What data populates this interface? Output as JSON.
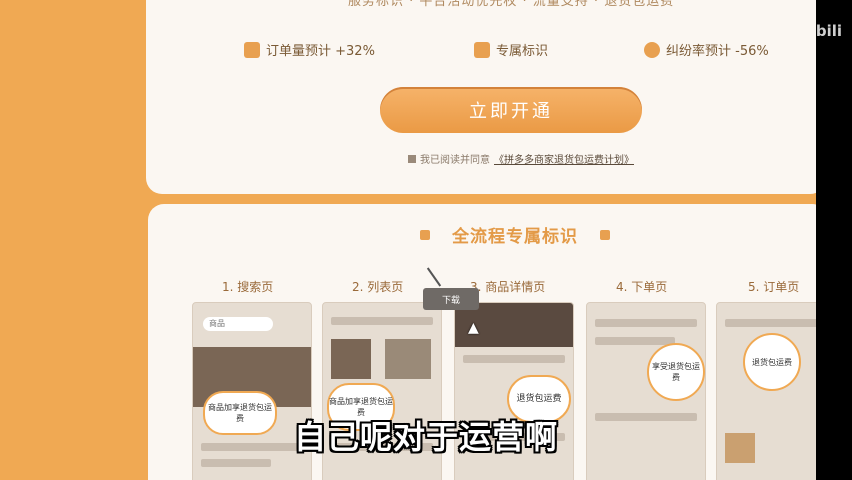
{
  "top_section": {
    "benefits_line": "服务标识 · 平台活动优先权 · 流量支持 · 退货包运费",
    "stats": [
      {
        "icon": "chart-up-icon",
        "label": "订单量预计 +32%"
      },
      {
        "icon": "bookmark-icon",
        "label": "专属标识"
      },
      {
        "icon": "shield-check-icon",
        "label": "纠纷率预计 -56%"
      }
    ],
    "open_button": "立即开通",
    "agreement_prefix": "我已阅读并同意",
    "agreement_link": "《拼多多商家退货包运费计划》"
  },
  "bottom_section": {
    "title": "全流程专属标识",
    "steps": [
      {
        "label": "1. 搜索页",
        "bubble": "商品加享退货包运费",
        "search_text": "商品"
      },
      {
        "label": "2. 列表页",
        "bubble": "商品加享退货包运费"
      },
      {
        "label": "3. 商品详情页",
        "bubble": "退货包运费"
      },
      {
        "label": "4. 下单页",
        "bubble": "享受退货包运费"
      },
      {
        "label": "5. 订单页",
        "bubble": "退货包运费"
      }
    ],
    "tooltip": "下载"
  },
  "subtitle": "自己呢对于运营啊",
  "watermark": "bili",
  "colors": {
    "accent": "#f0a953",
    "panel": "#fbf7f2",
    "title_orange": "#e39a47"
  }
}
